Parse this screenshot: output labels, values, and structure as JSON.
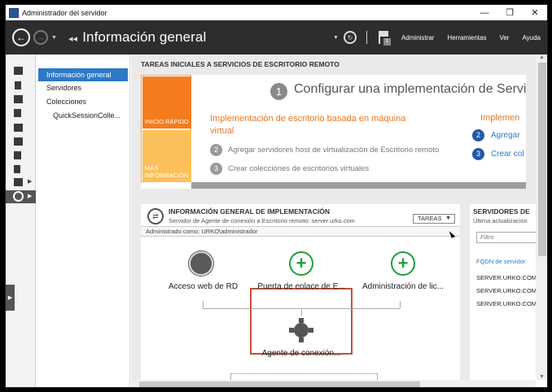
{
  "window": {
    "title": "Administrador del servidor",
    "controls": {
      "minimize": "—",
      "maximize": "❐",
      "close": "✕"
    }
  },
  "ribbon": {
    "breadcrumb_arrows": "◂◂",
    "breadcrumb": "Información general",
    "menu": [
      "Administrar",
      "Herramientas",
      "Ver",
      "Ayuda"
    ],
    "notification_count": "1"
  },
  "nav": {
    "items": [
      {
        "label": "Información general",
        "selected": true
      },
      {
        "label": "Servidores",
        "selected": false
      },
      {
        "label": "Colecciones",
        "selected": false
      },
      {
        "label": "QuickSessionColle...",
        "selected": false
      }
    ]
  },
  "quick_start": {
    "section_title": "TAREAS INICIALES A SERVICIOS DE ESCRITORIO REMOTO",
    "tile_quick": "INICIO RÁPIDO",
    "tile_more": "MÁS INFORMACIÓN",
    "step_number": "1",
    "step_title": "Configurar una implementación de Servic",
    "option_title": "Implementación de escritorio basada en máquina virtual",
    "option_steps": [
      {
        "n": "2",
        "text": "Agregar servidores host de virtualización de Escritorio remoto"
      },
      {
        "n": "3",
        "text": "Crear colecciones de escritorios virtuales"
      }
    ],
    "right_title": "Implemen",
    "right_steps": [
      {
        "n": "2",
        "text": "Agregar"
      },
      {
        "n": "3",
        "text": "Crear col"
      }
    ]
  },
  "deployment": {
    "title": "INFORMACIÓN GENERAL DE IMPLEMENTACIÓN",
    "subtitle": "Servidor de Agente de conexión a Escritorio remoto: server.urko.com",
    "tasks_button": "TAREAS",
    "managed_as": "Administrado como: URKO\\administrador",
    "nodes": {
      "web": "Acceso web de RD",
      "gateway": "Puerta de enlace de E...",
      "licensing": "Administración de lic...",
      "broker": "Agente de conexión..."
    }
  },
  "servers": {
    "title": "SERVIDORES DE",
    "subtitle": "Última actualización",
    "filter_placeholder": "Filtro",
    "column": "FQDN de servidor",
    "rows": [
      "SERVER.URKO.COM",
      "SERVER.URKO.COM",
      "SERVER.URKO.COM"
    ]
  }
}
